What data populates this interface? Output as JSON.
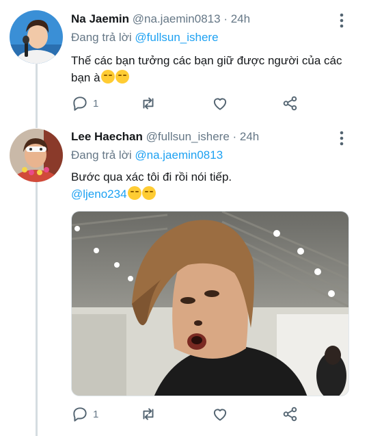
{
  "tweets": [
    {
      "name": "Na Jaemin",
      "handle": "@na.jaemin0813",
      "time": "· 24h",
      "replying_prefix": "Đang trả lời",
      "replying_to": "@fullsun_ishere",
      "text": "Thế các bạn tưởng các bạn giữ được người của các bạn à",
      "emojis": [
        "relieved-face",
        "relieved-face"
      ],
      "reply_count": "1",
      "has_media": false
    },
    {
      "name": "Lee Haechan",
      "handle": "@fullsun_ishere",
      "time": "· 24h",
      "replying_prefix": "Đang trả lời",
      "replying_to": "@na.jaemin0813",
      "text": "Bước qua xác tôi đi rồi nói tiếp.",
      "mention": "@ljeno234",
      "emojis": [
        "relieved-face",
        "relieved-face"
      ],
      "reply_count": "1",
      "has_media": true
    }
  ],
  "colors": {
    "accent": "#1da1f2",
    "muted": "#657786",
    "thread_line": "#d5dce1"
  },
  "icons": [
    "reply-icon",
    "retweet-icon",
    "like-icon",
    "share-icon",
    "more-options-icon"
  ]
}
